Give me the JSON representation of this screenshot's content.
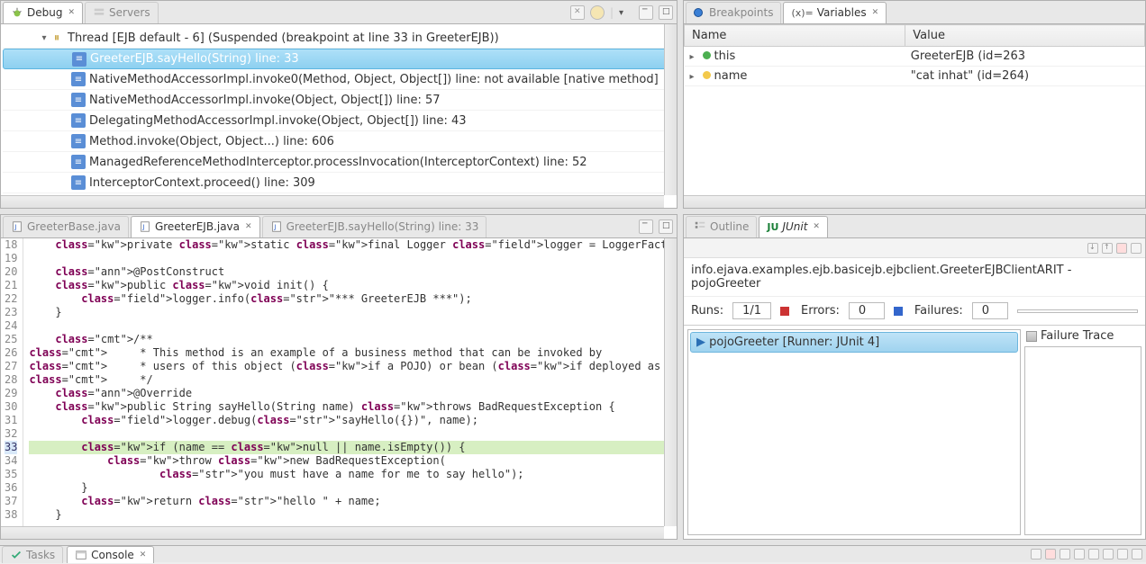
{
  "debug": {
    "tab_label": "Debug",
    "servers_tab_label": "Servers",
    "thread_label": "Thread [EJB default - 6] (Suspended (breakpoint at line 33 in GreeterEJB))",
    "stack": [
      "GreeterEJB.sayHello(String) line: 33",
      "NativeMethodAccessorImpl.invoke0(Method, Object, Object[]) line: not available [native method]",
      "NativeMethodAccessorImpl.invoke(Object, Object[]) line: 57",
      "DelegatingMethodAccessorImpl.invoke(Object, Object[]) line: 43",
      "Method.invoke(Object, Object...) line: 606",
      "ManagedReferenceMethodInterceptor.processInvocation(InterceptorContext) line: 52",
      "InterceptorContext.proceed() line: 309"
    ]
  },
  "variables": {
    "breakpoints_tab": "Breakpoints",
    "variables_tab": "Variables",
    "col_name": "Name",
    "col_value": "Value",
    "rows": [
      {
        "icon": "green",
        "name": "this",
        "value": "GreeterEJB  (id=263"
      },
      {
        "icon": "yellow",
        "name": "name",
        "value": "\"cat inhat\" (id=264)"
      }
    ]
  },
  "editor": {
    "tabs": [
      {
        "label": "GreeterBase.java",
        "active": false
      },
      {
        "label": "GreeterEJB.java",
        "active": true,
        "closable": true
      },
      {
        "label": "GreeterEJB.sayHello(String) line: 33",
        "active": false
      }
    ],
    "first_line": 18,
    "lines": [
      {
        "raw": "    private static final Logger logger = LoggerFactory.getLogger(GreeterEJB.class);"
      },
      {
        "raw": ""
      },
      {
        "raw": "    @PostConstruct"
      },
      {
        "raw": "    public void init() {"
      },
      {
        "raw": "        logger.info(\"*** GreeterEJB ***\");"
      },
      {
        "raw": "    }"
      },
      {
        "raw": ""
      },
      {
        "raw": "    /**"
      },
      {
        "raw": "     * This method is an example of a business method that can be invoked by"
      },
      {
        "raw": "     * users of this object (if a POJO) or bean (if deployed as an EJB)."
      },
      {
        "raw": "     */"
      },
      {
        "raw": "    @Override"
      },
      {
        "raw": "    public String sayHello(String name) throws BadRequestException {"
      },
      {
        "raw": "        logger.debug(\"sayHello({})\", name);"
      },
      {
        "raw": ""
      },
      {
        "raw": "        if (name == null || name.isEmpty()) {",
        "current": true
      },
      {
        "raw": "            throw new BadRequestException("
      },
      {
        "raw": "                    \"you must have a name for me to say hello\");"
      },
      {
        "raw": "        }"
      },
      {
        "raw": "        return \"hello \" + name;"
      },
      {
        "raw": "    }"
      }
    ]
  },
  "junit": {
    "outline_tab": "Outline",
    "junit_tab": "JUnit",
    "header_text": "info.ejava.examples.ejb.basicejb.ejbclient.GreeterEJBClientARIT - pojoGreeter",
    "runs_label": "Runs:",
    "runs_value": "1/1",
    "errors_label": "Errors:",
    "errors_value": "0",
    "failures_label": "Failures:",
    "failures_value": "0",
    "tree_item": "pojoGreeter [Runner: JUnit 4]",
    "failure_trace_label": "Failure Trace"
  },
  "bottom": {
    "tasks_tab": "Tasks",
    "console_tab": "Console"
  }
}
